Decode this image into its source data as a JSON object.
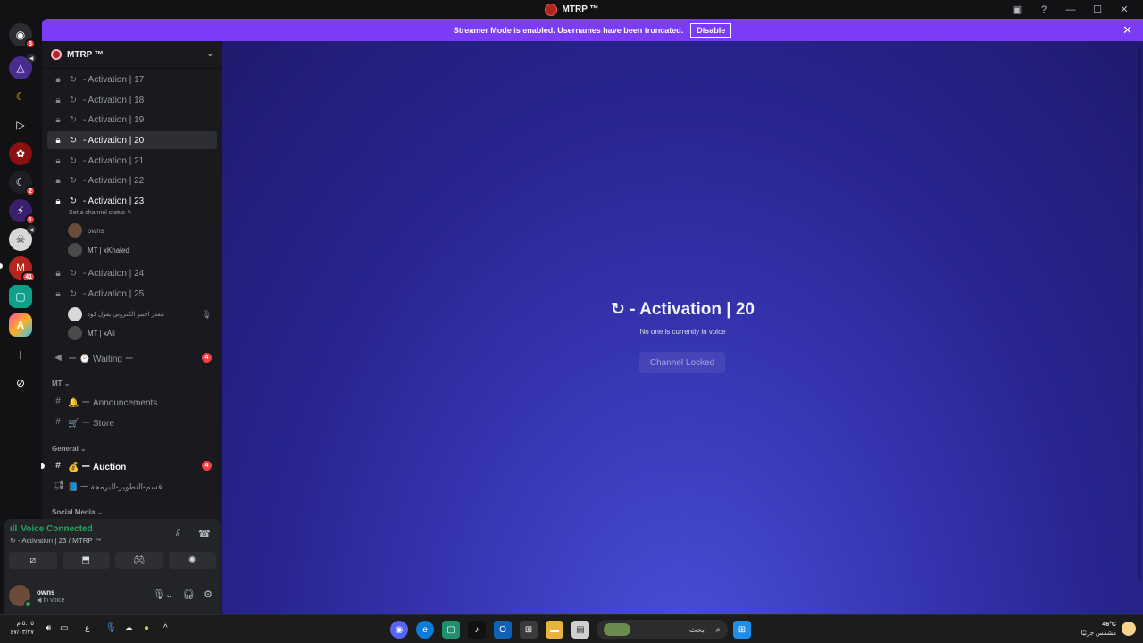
{
  "window": {
    "title": "MTRP ™"
  },
  "banner": {
    "text": "Streamer Mode is enabled. Usernames have been truncated.",
    "button": "Disable"
  },
  "rail": {
    "badges": {
      "s1": "3",
      "s6": "2",
      "s7": "1",
      "s9": "41"
    }
  },
  "server": {
    "name": "MTRP ™"
  },
  "channels": {
    "a17": "- Activation | 17",
    "a18": "- Activation | 18",
    "a19": "- Activation | 19",
    "a20": "- Activation | 20",
    "a21": "- Activation | 21",
    "a22": "- Activation | 22",
    "a23": "- Activation | 23",
    "a23_status": "Set a channel status",
    "a24": "- Activation | 24",
    "a25": "- Activation | 25",
    "waiting": "ー ⌚ Waiting ー",
    "waiting_count": "4"
  },
  "voice_users": {
    "a23_u1": "owns",
    "a23_u2": "MT | xKhaled",
    "a25_u1": "مقدر اختبر الكتروني يقول كود",
    "a25_u2": "MT | xAli"
  },
  "categories": {
    "mt": "MT ⌄",
    "general": "General ⌄",
    "social": "Social Media ⌄"
  },
  "text_channels": {
    "announcements": "🔔 ー Announcements",
    "store": "🛒 ー Store",
    "auction": "💰 ー Auction",
    "dev": "📘 ー قسم-التطوير-البرمجة",
    "auction_count": "4"
  },
  "voice_panel": {
    "status": "Voice Connected",
    "channel": "- Activation | 23 / MTRP ™"
  },
  "user": {
    "name": "owns",
    "status": "In voice"
  },
  "main": {
    "title": "- Activation | 20",
    "subtitle": "No one is currently in voice",
    "button": "Channel Locked"
  },
  "taskbar": {
    "time": "٥:٠٥ م",
    "date": "٤٧/٠٣/٢٧",
    "lang": "ع",
    "search": "بحث",
    "temp": "46°C",
    "weather": "مشمس جزئيًا"
  }
}
